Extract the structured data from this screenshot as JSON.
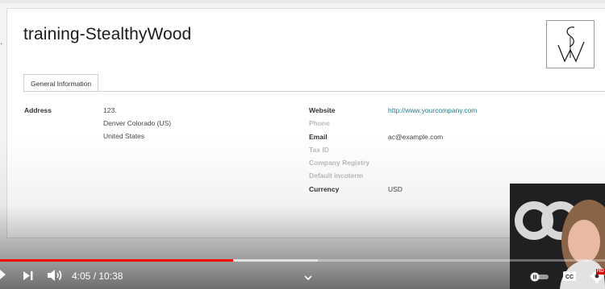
{
  "record": {
    "title": "training-StealthyWood",
    "tab": "General Information",
    "address_label": "Address",
    "address_lines": [
      "123.",
      "Denver  Colorado (US)",
      "United States"
    ],
    "fields": [
      {
        "label": "Website",
        "value": "http://www.yourcompany.com",
        "muted": false
      },
      {
        "label": "Phone",
        "value": "",
        "muted": true
      },
      {
        "label": "Email",
        "value": "ac@example.com",
        "muted": false
      },
      {
        "label": "Tax ID",
        "value": "",
        "muted": true
      },
      {
        "label": "Company Registry",
        "value": "",
        "muted": true
      },
      {
        "label": "Default incoterm",
        "value": "",
        "muted": true
      },
      {
        "label": "Currency",
        "value": "USD",
        "muted": false
      }
    ],
    "logo_letters": "SW"
  },
  "player": {
    "time": "4:05 / 10:38",
    "played_fraction": 0.385,
    "buffered_fraction": 0.525,
    "hd_badge": "HD",
    "icons": [
      "play-icon",
      "next-icon",
      "volume-icon",
      "chevron-down-icon",
      "autoplay-toggle-icon",
      "captions-icon",
      "settings-icon"
    ]
  },
  "colors": {
    "link": "#1e7b8a",
    "progress": "#ff0000",
    "hd_badge": "#cc0000"
  }
}
